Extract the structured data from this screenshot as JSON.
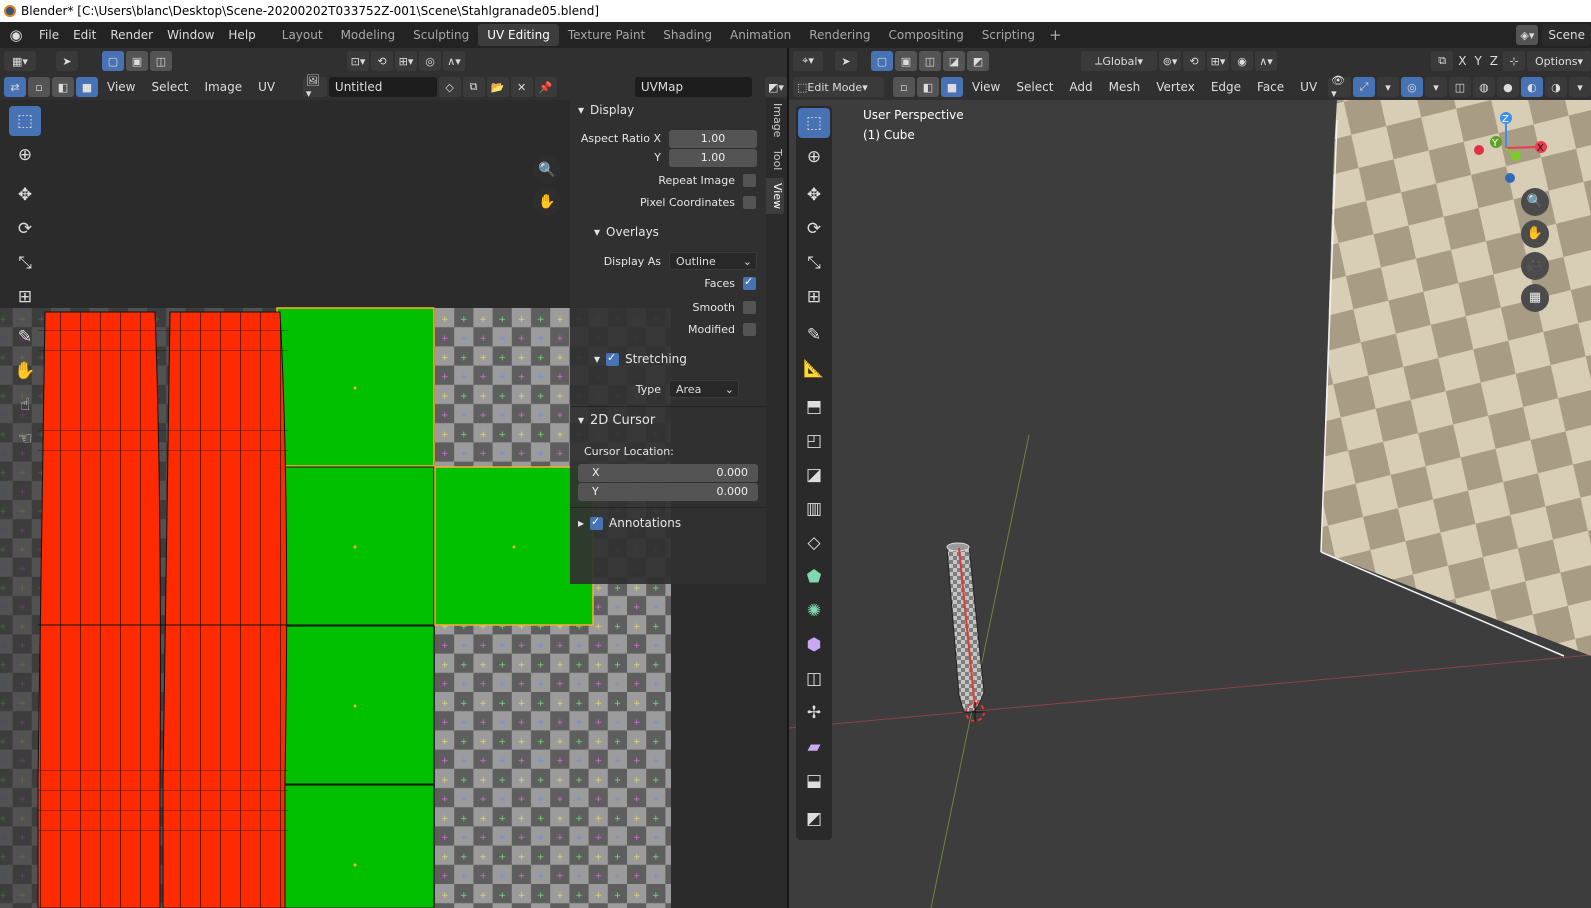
{
  "window": {
    "title": "Blender* [C:\\Users\\blanc\\Desktop\\Scene-20200202T033752Z-001\\Scene\\Stahlgranade05.blend]"
  },
  "menubar": {
    "menus": [
      "File",
      "Edit",
      "Render",
      "Window",
      "Help"
    ],
    "workspaces": [
      "Layout",
      "Modeling",
      "Sculpting",
      "UV Editing",
      "Texture Paint",
      "Shading",
      "Animation",
      "Rendering",
      "Compositing",
      "Scripting"
    ],
    "active_workspace": "UV Editing",
    "scene": "Scene"
  },
  "uv_editor": {
    "menus": [
      "View",
      "Select",
      "Image",
      "UV"
    ],
    "image_name": "Untitled",
    "uv_map": "UVMap",
    "sidebar_tabs": [
      "Image",
      "Tool",
      "View"
    ],
    "active_tab": "View",
    "panel": {
      "display_title": "Display",
      "aspect_label": "Aspect Ratio X",
      "aspect_x": "1.00",
      "y_label": "Y",
      "aspect_y": "1.00",
      "repeat_image": "Repeat Image",
      "pixel_coords": "Pixel Coordinates",
      "overlays_title": "Overlays",
      "display_as_label": "Display As",
      "display_as_value": "Outline",
      "faces_label": "Faces",
      "smooth_label": "Smooth",
      "modified_label": "Modified",
      "stretching_label": "Stretching",
      "type_label": "Type",
      "type_value": "Area",
      "cursor_title": "2D Cursor",
      "cursor_location": "Cursor Location:",
      "cursor_x_label": "X",
      "cursor_x": "0.000",
      "cursor_y_label": "Y",
      "cursor_y": "0.000",
      "annotations_label": "Annotations"
    },
    "colors": {
      "stretch_high": "#ff2a00",
      "stretch_low": "#00c000",
      "selected_edge": "#ffaa33"
    }
  },
  "viewport": {
    "mode": "Edit Mode",
    "menus": [
      "View",
      "Select",
      "Add",
      "Mesh",
      "Vertex",
      "Edge",
      "Face",
      "UV"
    ],
    "orientation": "Global",
    "axes": [
      "X",
      "Y",
      "Z"
    ],
    "options": "Options",
    "view_name": "User Perspective",
    "object_name": "(1) Cube",
    "gizmo": {
      "x": "X",
      "y": "Y",
      "z": "Z"
    }
  }
}
